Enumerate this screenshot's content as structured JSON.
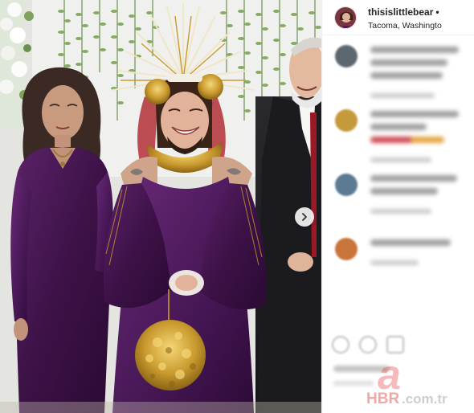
{
  "post": {
    "username": "thisislittlebear",
    "separator": "•",
    "location": "Tacoma, Washingto"
  },
  "comments": [
    {
      "avatar_color": "#5d6770"
    },
    {
      "avatar_color": "#c49a3a"
    },
    {
      "avatar_color": "#5b7a93"
    },
    {
      "avatar_color": "#c9743a"
    }
  ],
  "watermark": {
    "brand_letter": "a",
    "brand_text": "HBR",
    "domain_text": ".com.tr"
  },
  "colors": {
    "accent_red": "#e0323a",
    "gown_purple": "#4a1a55",
    "gold": "#c99a2e"
  }
}
